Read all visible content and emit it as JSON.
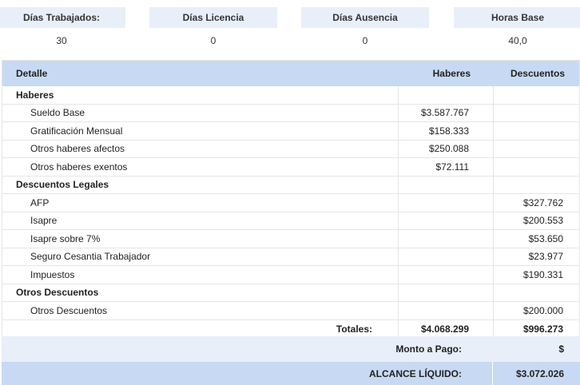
{
  "stats": [
    {
      "label": "Días Trabajados:",
      "value": "30"
    },
    {
      "label": "Días Licencia",
      "value": "0"
    },
    {
      "label": "Días Ausencia",
      "value": "0"
    },
    {
      "label": "Horas Base",
      "value": "40,0"
    }
  ],
  "table": {
    "headers": {
      "detalle": "Detalle",
      "haberes": "Haberes",
      "descuentos": "Descuentos"
    },
    "groups": [
      {
        "title": "Haberes",
        "items": [
          {
            "label": "Sueldo Base",
            "haberes": "$3.587.767",
            "descuentos": ""
          },
          {
            "label": "Gratificación Mensual",
            "haberes": "$158.333",
            "descuentos": ""
          },
          {
            "label": "Otros haberes afectos",
            "haberes": "$250.088",
            "descuentos": ""
          },
          {
            "label": "Otros haberes exentos",
            "haberes": "$72.111",
            "descuentos": ""
          }
        ]
      },
      {
        "title": "Descuentos Legales",
        "items": [
          {
            "label": "AFP",
            "haberes": "",
            "descuentos": "$327.762"
          },
          {
            "label": "Isapre",
            "haberes": "",
            "descuentos": "$200.553"
          },
          {
            "label": "Isapre sobre 7%",
            "haberes": "",
            "descuentos": "$53.650"
          },
          {
            "label": "Seguro Cesantia Trabajador",
            "haberes": "",
            "descuentos": "$23.977"
          },
          {
            "label": "Impuestos",
            "haberes": "",
            "descuentos": "$190.331"
          }
        ]
      },
      {
        "title": "Otros Descuentos",
        "items": [
          {
            "label": "Otros Descuentos",
            "haberes": "",
            "descuentos": "$200.000"
          }
        ]
      }
    ],
    "totals": {
      "label": "Totales:",
      "haberes": "$4.068.299",
      "descuentos": "$996.273"
    }
  },
  "monto_pago": {
    "label": "Monto a Pago:",
    "value": "$"
  },
  "alcance_liquido": {
    "label": "ALCANCE LÍQUIDO:",
    "value": "$3.072.026"
  }
}
